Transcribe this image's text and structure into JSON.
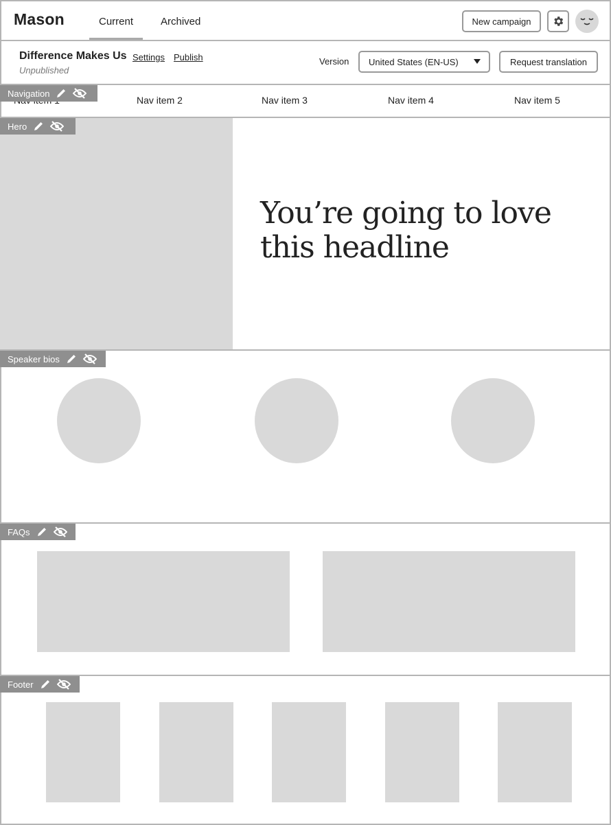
{
  "app": {
    "name": "Mason",
    "tabs": [
      {
        "label": "Current",
        "active": true
      },
      {
        "label": "Archived",
        "active": false
      }
    ],
    "new_campaign_label": "New campaign",
    "settings_icon": "gear-icon",
    "avatar_icon": "smiley-avatar-icon"
  },
  "campaign": {
    "title": "Difference Makes Us",
    "settings_link": "Settings",
    "publish_link": "Publish",
    "status": "Unpublished",
    "version_label": "Version",
    "version_value": "United States (EN-US)",
    "request_translation_label": "Request translation"
  },
  "sections": {
    "navigation": {
      "tag": "Navigation",
      "items": [
        "Nav item 1",
        "Nav item 2",
        "Nav item 3",
        "Nav item 4",
        "Nav item 5"
      ]
    },
    "hero": {
      "tag": "Hero",
      "headline": "You’re going to love this headline"
    },
    "speakers": {
      "tag": "Speaker bios"
    },
    "faqs": {
      "tag": "FAQs"
    },
    "footer": {
      "tag": "Footer"
    }
  },
  "tag_icons": [
    "pencil-icon",
    "eye-off-icon"
  ],
  "colors": {
    "border": "#b5b5b5",
    "tag_bg": "#8f8f8f",
    "placeholder": "#d9d9d9",
    "text": "#222222",
    "muted": "#777777"
  }
}
